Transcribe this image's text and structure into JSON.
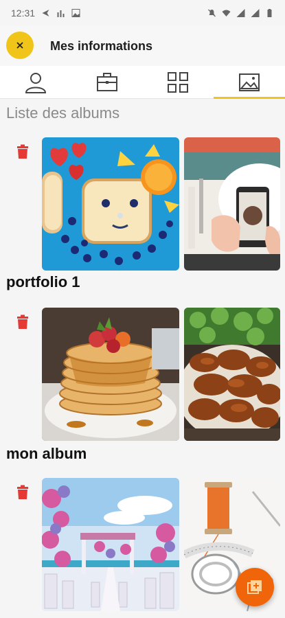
{
  "status_bar": {
    "time": "12:31"
  },
  "header": {
    "title": "Mes informations",
    "close_icon": "close-icon"
  },
  "tabs": [
    {
      "icon": "user-icon",
      "active": false
    },
    {
      "icon": "briefcase-icon",
      "active": false
    },
    {
      "icon": "grid-icon",
      "active": false
    },
    {
      "icon": "image-icon",
      "active": true
    }
  ],
  "section_title": "Liste des albums",
  "albums": [
    {
      "name": "portfolio 1",
      "delete_icon": "trash-icon"
    },
    {
      "name": "mon album",
      "delete_icon": "trash-icon"
    },
    {
      "name": "",
      "delete_icon": "trash-icon"
    }
  ],
  "fab": {
    "icon": "add-album-icon"
  },
  "colors": {
    "accent": "#f0c419",
    "delete": "#e53935",
    "fab": "#f0640a"
  }
}
